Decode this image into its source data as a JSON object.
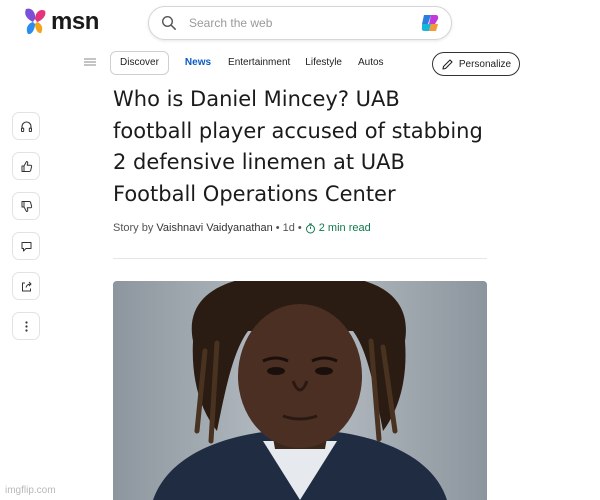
{
  "header": {
    "logo_text": "msn",
    "search_placeholder": "Search the web"
  },
  "nav": {
    "items": [
      {
        "label": "Discover",
        "style": "pill"
      },
      {
        "label": "News",
        "style": "active"
      },
      {
        "label": "Entertainment",
        "style": "plain"
      },
      {
        "label": "Lifestyle",
        "style": "plain"
      },
      {
        "label": "Autos",
        "style": "plain"
      }
    ],
    "personalize_label": "Personalize"
  },
  "rail": {
    "icons": [
      "headphones-icon",
      "thumbs-up-icon",
      "thumbs-down-icon",
      "comment-icon",
      "share-icon",
      "more-icon"
    ]
  },
  "article": {
    "title_lines": [
      "Who is Daniel Mincey? UAB",
      "football player accused of stabbing",
      "2 defensive linemen at UAB",
      "Football Operations Center"
    ],
    "byline": {
      "prefix": "Story by",
      "author": "Vaishnavi Vaidyanathan",
      "age": "1d",
      "read_time": "2 min read",
      "separator": "•"
    }
  },
  "watermark": "imgflip.com",
  "colors": {
    "accent": "#0a5bc4",
    "read_time": "#0f7a4a"
  }
}
